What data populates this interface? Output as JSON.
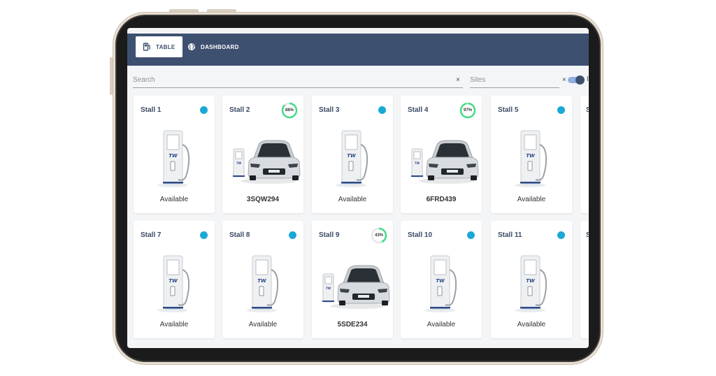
{
  "nav": {
    "tabs": [
      {
        "label": "TABLE",
        "icon": "ev-charger-icon",
        "active": true
      },
      {
        "label": "DASHBOARD",
        "icon": "globe-icon",
        "active": false
      }
    ]
  },
  "filters": {
    "search_placeholder": "Search",
    "sites_placeholder": "Sites",
    "clear_glyph": "×",
    "toggle_on": true,
    "toggle_label": "I"
  },
  "colors": {
    "header": "#3d5070",
    "available_dot": "#1aa9d6",
    "charge_ring": "#3ddc84",
    "charger_brand": "#2d4a8a"
  },
  "stalls": [
    {
      "name": "Stall 1",
      "occupied": false,
      "status": "Available"
    },
    {
      "name": "Stall 2",
      "occupied": true,
      "charge_percent": 88,
      "charge_label": "88%",
      "plate": "3SQW294"
    },
    {
      "name": "Stall 3",
      "occupied": false,
      "status": "Available"
    },
    {
      "name": "Stall 4",
      "occupied": true,
      "charge_percent": 97,
      "charge_label": "97%",
      "plate": "6FRD439"
    },
    {
      "name": "Stall 5",
      "occupied": false,
      "status": "Available"
    },
    {
      "name": "Stall 7",
      "occupied": false,
      "status": "Available"
    },
    {
      "name": "Stall 8",
      "occupied": false,
      "status": "Available"
    },
    {
      "name": "Stall 9",
      "occupied": true,
      "charge_percent": 43,
      "charge_label": "43%",
      "plate": "5SDE234"
    },
    {
      "name": "Stall 10",
      "occupied": false,
      "status": "Available"
    },
    {
      "name": "Stall 11",
      "occupied": false,
      "status": "Available"
    }
  ],
  "partial_labels": [
    "S",
    "S"
  ],
  "charger_logo_text": "TW"
}
